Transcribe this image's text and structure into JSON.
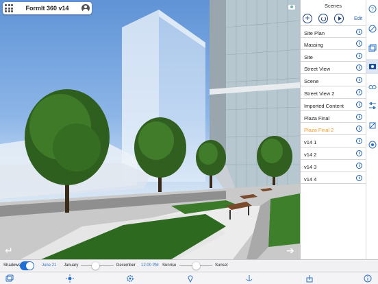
{
  "app": {
    "title": "FormIt 360 v14"
  },
  "scenes_panel": {
    "title": "Scenes",
    "add_label": "+",
    "edit_label": "Edit",
    "info_glyph": "i",
    "items": [
      {
        "label": "Site Plan",
        "active": false
      },
      {
        "label": "Massing",
        "active": false
      },
      {
        "label": "Site",
        "active": false
      },
      {
        "label": "Street View",
        "active": false
      },
      {
        "label": "Scene",
        "active": false
      },
      {
        "label": "Street View 2",
        "active": false
      },
      {
        "label": "Imported Content",
        "active": false
      },
      {
        "label": "Plaza Final",
        "active": false
      },
      {
        "label": "Plaza Final 2",
        "active": true
      },
      {
        "label": "v14 1",
        "active": false
      },
      {
        "label": "v14 2",
        "active": false
      },
      {
        "label": "v14 3",
        "active": false
      },
      {
        "label": "v14 4",
        "active": false
      }
    ]
  },
  "shadow_options": {
    "shadows_label": "Shadows",
    "shadows_on": true,
    "date": "June 21",
    "month_start": "January",
    "month_end": "December",
    "month_slider_fraction": 0.45,
    "time": "12:00 PM",
    "time_start": "Sunrise",
    "time_end": "Sunset",
    "time_slider_fraction": 0.5
  },
  "colors": {
    "accent": "#2a6fc4",
    "active_scene": "#f09a29",
    "toggle_on": "#1f6fd6"
  },
  "icons": {
    "right_strip": [
      "help-icon",
      "sketch-icon",
      "layers-icon",
      "scenes-icon",
      "glasses-icon",
      "levels-icon",
      "settings-icon",
      "materials-icon"
    ],
    "bottom_tabs": [
      "layers-icon",
      "sun-icon",
      "settings-icon",
      "location-icon",
      "anchor-icon",
      "share-icon",
      "info-icon"
    ]
  }
}
